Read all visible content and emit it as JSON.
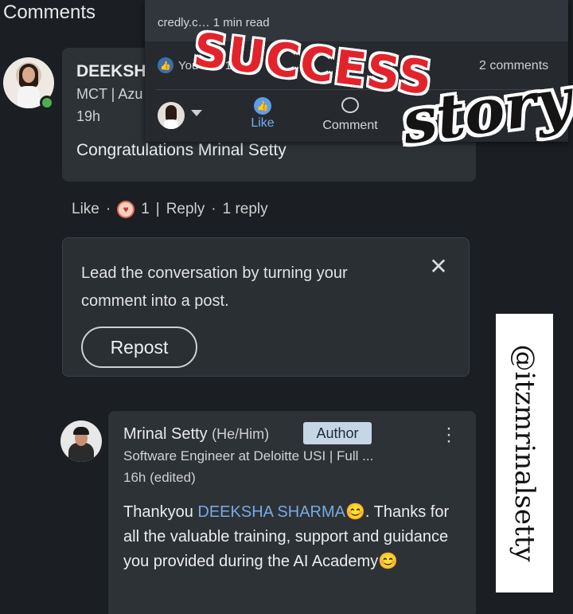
{
  "header": {
    "title": "Comments"
  },
  "overlay": {
    "link_text": "credly.c…  1 min read",
    "reactions_text": "You and 1…",
    "comments_count": "2 comments",
    "like_label": "Like",
    "comment_label": "Comment"
  },
  "comment1": {
    "name": "DEEKSH",
    "headline": "MCT | Azu",
    "time": "19h",
    "text": "Congratulations Mrinal Setty",
    "actions": {
      "like": "Like",
      "reaction_count": "1",
      "reply": "Reply",
      "replies": "1 reply"
    }
  },
  "repost_prompt": {
    "text": "Lead the conversation by turning your comment into a post.",
    "button": "Repost"
  },
  "reply": {
    "name": "Mrinal Setty",
    "pronouns": "(He/Him)",
    "badge": "Author",
    "headline": "Software Engineer at Deloitte USI | Full ...",
    "time": "16h (edited)",
    "text_before": "Thankyou ",
    "mention": "DEEKSHA SHARMA",
    "text_after": "😊. Thanks for all the valuable training, support and guidance you provided during the AI Academy😊"
  },
  "sticker": {
    "line1": "SUCCESS",
    "line2": "story"
  },
  "watermark": {
    "handle": "@itzmrinalsetty"
  },
  "colors": {
    "accent_blue": "#78a9e0",
    "background": "#1b1f23",
    "sticker_red": "#e3232b"
  }
}
